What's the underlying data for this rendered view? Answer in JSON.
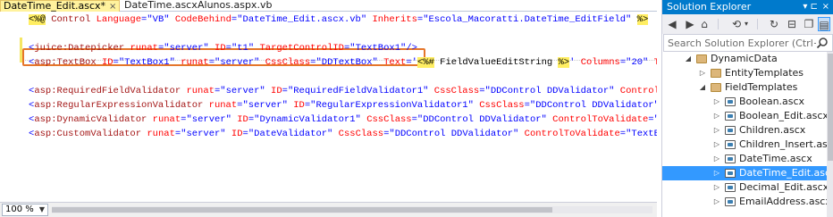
{
  "editor": {
    "tabs": [
      {
        "label": "DateTime_Edit.ascx*",
        "close": "×"
      },
      {
        "label": "DateTime.ascx"
      },
      {
        "label": "Alunos.aspx.vb"
      }
    ],
    "lines": [
      [
        {
          "t": "<%@",
          "c": "dlm"
        },
        {
          "t": " Control ",
          "c": "tag"
        },
        {
          "t": "Language",
          "c": "attr"
        },
        {
          "t": "=",
          "c": "ang"
        },
        {
          "t": "\"VB\"",
          "c": "val"
        },
        {
          "t": " ",
          "c": "txt"
        },
        {
          "t": "CodeBehind",
          "c": "attr"
        },
        {
          "t": "=",
          "c": "ang"
        },
        {
          "t": "\"DateTime_Edit.ascx.vb\"",
          "c": "val"
        },
        {
          "t": " ",
          "c": "txt"
        },
        {
          "t": "Inherits",
          "c": "attr"
        },
        {
          "t": "=",
          "c": "ang"
        },
        {
          "t": "\"Escola_Macoratti.DateTime_EditField\"",
          "c": "val"
        },
        {
          "t": " ",
          "c": "txt"
        },
        {
          "t": "%>",
          "c": "dlm"
        }
      ],
      [],
      [
        {
          "t": "<",
          "c": "ang"
        },
        {
          "t": "juice:Datepicker",
          "c": "tag"
        },
        {
          "t": " ",
          "c": "txt"
        },
        {
          "t": "runat",
          "c": "attr"
        },
        {
          "t": "=",
          "c": "ang"
        },
        {
          "t": "\"server\"",
          "c": "val"
        },
        {
          "t": " ",
          "c": "txt"
        },
        {
          "t": "ID",
          "c": "attr"
        },
        {
          "t": "=",
          "c": "ang"
        },
        {
          "t": "\"t1\"",
          "c": "val"
        },
        {
          "t": " ",
          "c": "txt"
        },
        {
          "t": "TargetControlID",
          "c": "attr"
        },
        {
          "t": "=",
          "c": "ang"
        },
        {
          "t": "\"TextBox1\"",
          "c": "val"
        },
        {
          "t": "/>",
          "c": "ang"
        }
      ],
      [
        {
          "t": "<",
          "c": "ang"
        },
        {
          "t": "asp:TextBox",
          "c": "tag"
        },
        {
          "t": " ",
          "c": "txt"
        },
        {
          "t": "ID",
          "c": "attr"
        },
        {
          "t": "=",
          "c": "ang"
        },
        {
          "t": "\"TextBox1\"",
          "c": "val"
        },
        {
          "t": " ",
          "c": "txt"
        },
        {
          "t": "runat",
          "c": "attr"
        },
        {
          "t": "=",
          "c": "ang"
        },
        {
          "t": "\"server\"",
          "c": "val"
        },
        {
          "t": " ",
          "c": "txt"
        },
        {
          "t": "CssClass",
          "c": "attr"
        },
        {
          "t": "=",
          "c": "ang"
        },
        {
          "t": "\"DDTextBox\"",
          "c": "val"
        },
        {
          "t": " ",
          "c": "txt"
        },
        {
          "t": "Text",
          "c": "attr"
        },
        {
          "t": "=",
          "c": "ang"
        },
        {
          "t": "'",
          "c": "val"
        },
        {
          "t": "<%#",
          "c": "dlm"
        },
        {
          "t": " FieldValueEditString ",
          "c": "txt"
        },
        {
          "t": "%>",
          "c": "dlm"
        },
        {
          "t": "'",
          "c": "val"
        },
        {
          "t": " ",
          "c": "txt"
        },
        {
          "t": "Columns",
          "c": "attr"
        },
        {
          "t": "=",
          "c": "ang"
        },
        {
          "t": "\"20\"",
          "c": "val"
        },
        {
          "t": " ",
          "c": "txt"
        },
        {
          "t": "T",
          "c": "attr"
        }
      ],
      [],
      [
        {
          "t": "<",
          "c": "ang"
        },
        {
          "t": "asp:RequiredFieldValidator",
          "c": "tag"
        },
        {
          "t": " ",
          "c": "txt"
        },
        {
          "t": "runat",
          "c": "attr"
        },
        {
          "t": "=",
          "c": "ang"
        },
        {
          "t": "\"server\"",
          "c": "val"
        },
        {
          "t": " ",
          "c": "txt"
        },
        {
          "t": "ID",
          "c": "attr"
        },
        {
          "t": "=",
          "c": "ang"
        },
        {
          "t": "\"RequiredFieldValidator1\"",
          "c": "val"
        },
        {
          "t": " ",
          "c": "txt"
        },
        {
          "t": "CssClass",
          "c": "attr"
        },
        {
          "t": "=",
          "c": "ang"
        },
        {
          "t": "\"DDControl DDValidator\"",
          "c": "val"
        },
        {
          "t": " ",
          "c": "txt"
        },
        {
          "t": "Control",
          "c": "attr"
        }
      ],
      [
        {
          "t": "<",
          "c": "ang"
        },
        {
          "t": "asp:RegularExpressionValidator",
          "c": "tag"
        },
        {
          "t": " ",
          "c": "txt"
        },
        {
          "t": "runat",
          "c": "attr"
        },
        {
          "t": "=",
          "c": "ang"
        },
        {
          "t": "\"server\"",
          "c": "val"
        },
        {
          "t": " ",
          "c": "txt"
        },
        {
          "t": "ID",
          "c": "attr"
        },
        {
          "t": "=",
          "c": "ang"
        },
        {
          "t": "\"RegularExpressionValidator1\"",
          "c": "val"
        },
        {
          "t": " ",
          "c": "txt"
        },
        {
          "t": "CssClass",
          "c": "attr"
        },
        {
          "t": "=",
          "c": "ang"
        },
        {
          "t": "\"DDControl DDValidator\"",
          "c": "val"
        }
      ],
      [
        {
          "t": "<",
          "c": "ang"
        },
        {
          "t": "asp:DynamicValidator",
          "c": "tag"
        },
        {
          "t": " ",
          "c": "txt"
        },
        {
          "t": "runat",
          "c": "attr"
        },
        {
          "t": "=",
          "c": "ang"
        },
        {
          "t": "\"server\"",
          "c": "val"
        },
        {
          "t": " ",
          "c": "txt"
        },
        {
          "t": "ID",
          "c": "attr"
        },
        {
          "t": "=",
          "c": "ang"
        },
        {
          "t": "\"DynamicValidator1\"",
          "c": "val"
        },
        {
          "t": " ",
          "c": "txt"
        },
        {
          "t": "CssClass",
          "c": "attr"
        },
        {
          "t": "=",
          "c": "ang"
        },
        {
          "t": "\"DDControl DDValidator\"",
          "c": "val"
        },
        {
          "t": " ",
          "c": "txt"
        },
        {
          "t": "ControlToValidate",
          "c": "attr"
        },
        {
          "t": "=",
          "c": "ang"
        },
        {
          "t": "\"Tex",
          "c": "val"
        }
      ],
      [
        {
          "t": "<",
          "c": "ang"
        },
        {
          "t": "asp:CustomValidator",
          "c": "tag"
        },
        {
          "t": " ",
          "c": "txt"
        },
        {
          "t": "runat",
          "c": "attr"
        },
        {
          "t": "=",
          "c": "ang"
        },
        {
          "t": "\"server\"",
          "c": "val"
        },
        {
          "t": " ",
          "c": "txt"
        },
        {
          "t": "ID",
          "c": "attr"
        },
        {
          "t": "=",
          "c": "ang"
        },
        {
          "t": "\"DateValidator\"",
          "c": "val"
        },
        {
          "t": " ",
          "c": "txt"
        },
        {
          "t": "CssClass",
          "c": "attr"
        },
        {
          "t": "=",
          "c": "ang"
        },
        {
          "t": "\"DDControl DDValidator\"",
          "c": "val"
        },
        {
          "t": " ",
          "c": "txt"
        },
        {
          "t": "ControlToValidate",
          "c": "attr"
        },
        {
          "t": "=",
          "c": "ang"
        },
        {
          "t": "\"TextB",
          "c": "val"
        }
      ]
    ],
    "zoom": "100 %"
  },
  "solution_explorer": {
    "title": "Solution Explorer",
    "pin": "▾ ⊏",
    "close": "×",
    "toolbar": {
      "back": "◀",
      "forward": "▶",
      "home": "⌂",
      "history": "⟲",
      "history_arrow": "▾",
      "refresh": "↻",
      "collapse": "⊟",
      "copy": "❐",
      "properties": "▤"
    },
    "search_placeholder": "Search Solution Explorer (Ctrl+ç)",
    "items": [
      {
        "label": "DynamicData",
        "expander": "◢",
        "icon": "folder",
        "level": 0,
        "selected": false
      },
      {
        "label": "EntityTemplates",
        "expander": "▷",
        "icon": "folder",
        "level": 1,
        "selected": false
      },
      {
        "label": "FieldTemplates",
        "expander": "◢",
        "icon": "folder",
        "level": 1,
        "selected": false
      },
      {
        "label": "Boolean.ascx",
        "expander": "▷",
        "icon": "file",
        "level": 2,
        "selected": false
      },
      {
        "label": "Boolean_Edit.ascx",
        "expander": "▷",
        "icon": "file",
        "level": 2,
        "selected": false
      },
      {
        "label": "Children.ascx",
        "expander": "▷",
        "icon": "file",
        "level": 2,
        "selected": false
      },
      {
        "label": "Children_Insert.ascx",
        "expander": "▷",
        "icon": "file",
        "level": 2,
        "selected": false
      },
      {
        "label": "DateTime.ascx",
        "expander": "▷",
        "icon": "file",
        "level": 2,
        "selected": false
      },
      {
        "label": "DateTime_Edit.ascx",
        "expander": "▷",
        "icon": "file",
        "level": 2,
        "selected": true
      },
      {
        "label": "Decimal_Edit.ascx",
        "expander": "▷",
        "icon": "file",
        "level": 2,
        "selected": false
      },
      {
        "label": "EmailAddress.ascx",
        "expander": "▷",
        "icon": "file",
        "level": 2,
        "selected": false
      }
    ]
  },
  "colors": {
    "accent": "#007acc",
    "selection": "#3399ff",
    "highlight_border": "#e5762b",
    "tab_active": "#fff29d"
  }
}
